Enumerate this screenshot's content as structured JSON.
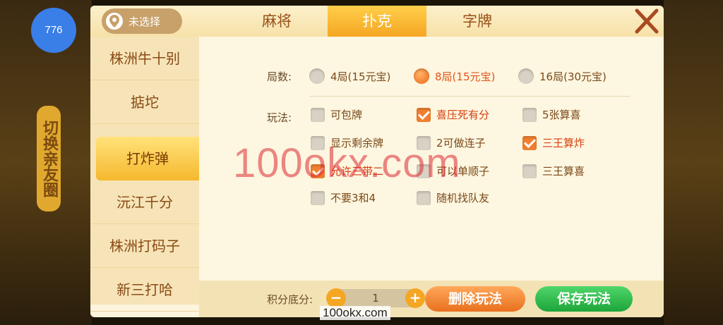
{
  "user": {
    "avatar_text": "776"
  },
  "background": {
    "side_label": "切换亲友圈"
  },
  "location": {
    "label": "未选择"
  },
  "tabs": [
    {
      "label": "麻将",
      "active": false
    },
    {
      "label": "扑克",
      "active": true
    },
    {
      "label": "字牌",
      "active": false
    }
  ],
  "sidebar": {
    "items": [
      {
        "label": "株洲牛十别"
      },
      {
        "label": "掂坨"
      },
      {
        "label": "打炸弹",
        "active": true
      },
      {
        "label": "沅江千分"
      },
      {
        "label": "株洲打码子"
      },
      {
        "label": "新三打哈"
      }
    ]
  },
  "rounds": {
    "label": "局数:",
    "options": [
      {
        "label": "4局(15元宝)",
        "selected": false
      },
      {
        "label": "8局(15元宝)",
        "selected": true
      },
      {
        "label": "16局(30元宝)",
        "selected": false
      }
    ]
  },
  "rules": {
    "label": "玩法:",
    "options": [
      {
        "label": "可包牌",
        "checked": false
      },
      {
        "label": "喜压死有分",
        "checked": true
      },
      {
        "label": "5张算喜",
        "checked": false
      },
      {
        "label": "显示剩余牌",
        "checked": false
      },
      {
        "label": "2可做连子",
        "checked": false
      },
      {
        "label": "三王算炸",
        "checked": true
      },
      {
        "label": "允许三带二",
        "checked": true
      },
      {
        "label": "可以单顺子",
        "checked": false
      },
      {
        "label": "三王算喜",
        "checked": false
      },
      {
        "label": "不要3和4",
        "checked": false
      },
      {
        "label": "随机找队友",
        "checked": false
      }
    ]
  },
  "score": {
    "label": "积分底分:",
    "value": "1",
    "minus": "−",
    "plus": "+"
  },
  "buttons": {
    "delete": "删除玩法",
    "save": "保存玩法"
  },
  "watermark": {
    "center": "100okx.com",
    "bottom": "100okx.com"
  },
  "colors": {
    "accent_orange": "#f5a623",
    "save_green": "#1ea53a",
    "delete_orange": "#e8701e",
    "checked_text": "#d84010"
  }
}
